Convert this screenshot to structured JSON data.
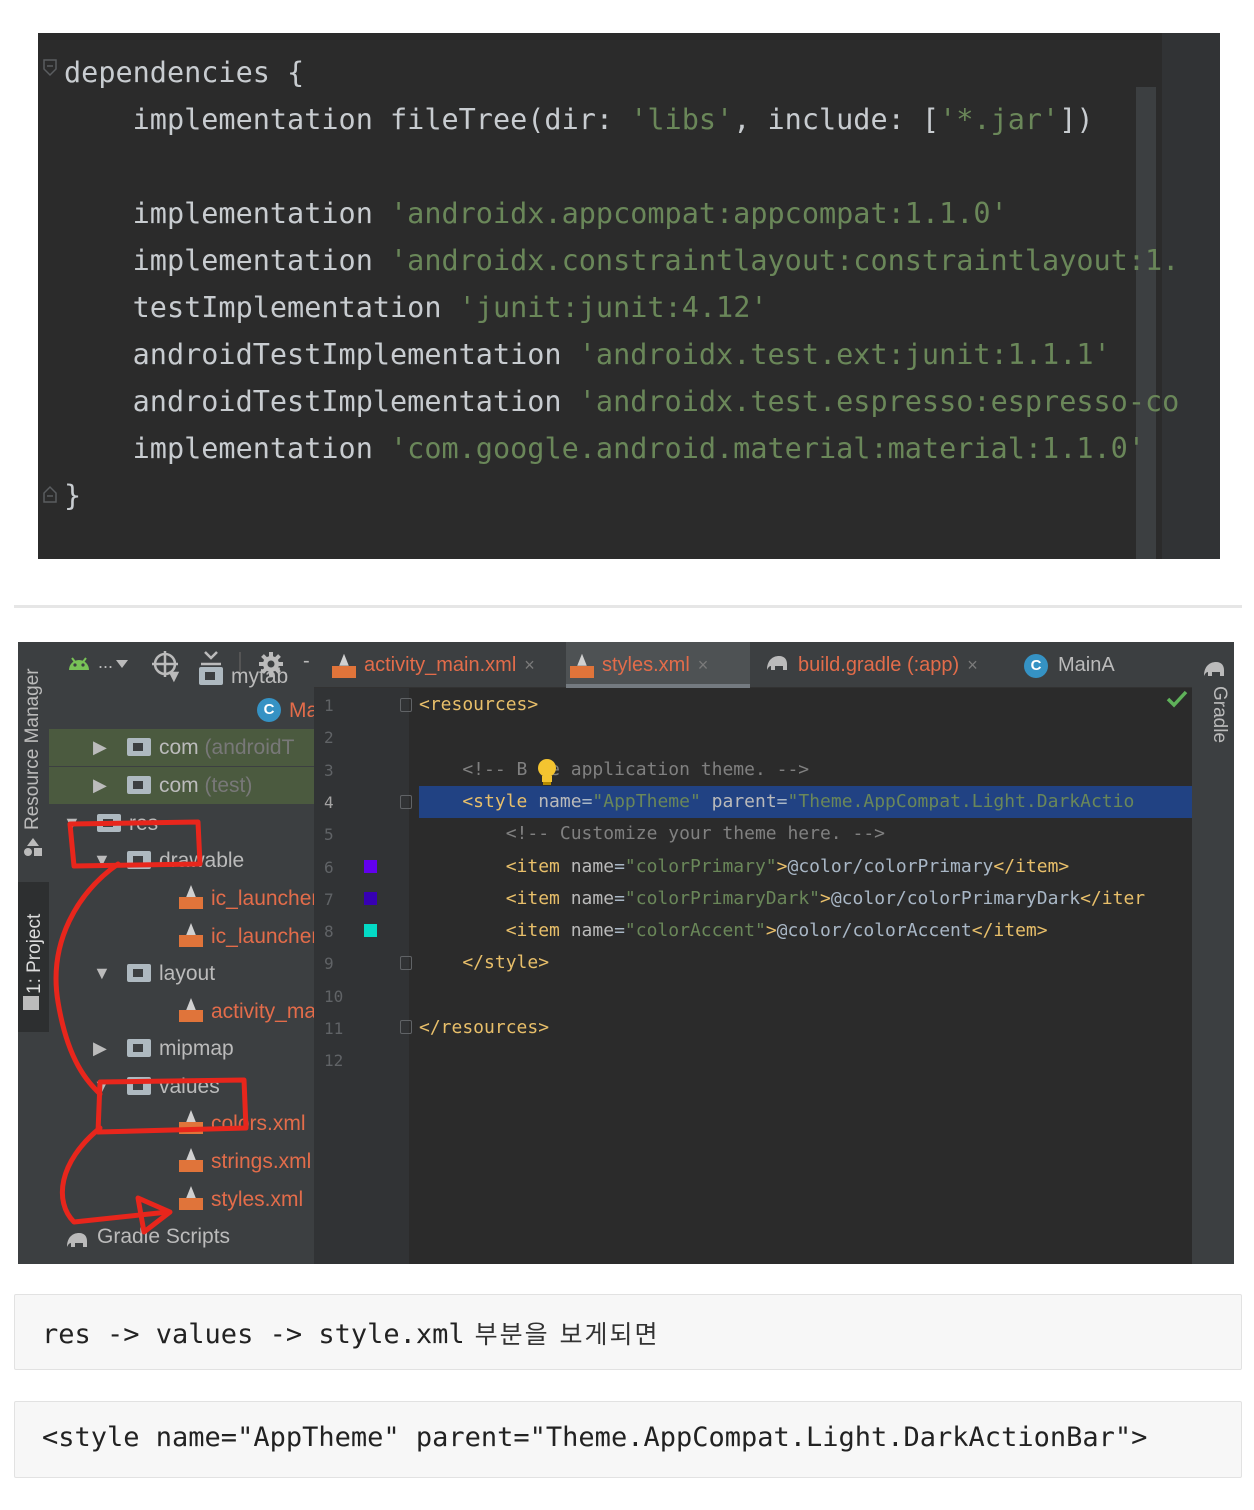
{
  "top_code": {
    "lines": [
      {
        "parts": [
          {
            "t": "dependencies {",
            "c": "plain"
          }
        ]
      },
      {
        "parts": [
          {
            "t": "    implementation fileTree(dir: ",
            "c": "plain"
          },
          {
            "t": "'libs'",
            "c": "str"
          },
          {
            "t": ", include: [",
            "c": "plain"
          },
          {
            "t": "'*.jar'",
            "c": "str"
          },
          {
            "t": "])",
            "c": "plain"
          }
        ]
      },
      {
        "parts": [
          {
            "t": "",
            "c": "plain"
          }
        ]
      },
      {
        "parts": [
          {
            "t": "    implementation ",
            "c": "plain"
          },
          {
            "t": "'androidx.appcompat:appcompat:1.1.0'",
            "c": "str"
          }
        ]
      },
      {
        "parts": [
          {
            "t": "    implementation ",
            "c": "plain"
          },
          {
            "t": "'androidx.constraintlayout:constraintlayout:1.",
            "c": "str"
          }
        ]
      },
      {
        "parts": [
          {
            "t": "    testImplementation ",
            "c": "plain"
          },
          {
            "t": "'junit:junit:4.12'",
            "c": "str"
          }
        ]
      },
      {
        "parts": [
          {
            "t": "    androidTestImplementation ",
            "c": "plain"
          },
          {
            "t": "'androidx.test.ext:junit:1.1.1'",
            "c": "str"
          }
        ]
      },
      {
        "parts": [
          {
            "t": "    androidTestImplementation ",
            "c": "plain"
          },
          {
            "t": "'androidx.test.espresso:espresso-co",
            "c": "str"
          }
        ]
      },
      {
        "parts": [
          {
            "t": "    implementation ",
            "c": "plain"
          },
          {
            "t": "'com.google.android.material:material:1.1.0'",
            "c": "str"
          }
        ]
      },
      {
        "parts": [
          {
            "t": "}",
            "c": "plain"
          }
        ]
      }
    ]
  },
  "side_tabs": {
    "resource_manager": "Resource Manager",
    "project": "1: Project",
    "gradle": "Gradle"
  },
  "toolbar": {
    "dots": "...",
    "hide": "-"
  },
  "tree": [
    {
      "label": "mytab",
      "icon": "folder-icon",
      "kind": "folder",
      "muted": ""
    },
    {
      "label": "Mai",
      "icon": "class-icon",
      "kind": "class",
      "muted": ""
    },
    {
      "label": "com",
      "icon": "folder-icon",
      "kind": "folder",
      "muted": " (androidT"
    },
    {
      "label": "com",
      "icon": "folder-icon",
      "kind": "folder",
      "muted": " (test)"
    },
    {
      "label": "res",
      "icon": "res-folder-icon",
      "kind": "folder",
      "muted": ""
    },
    {
      "label": "drawable",
      "icon": "folder-icon",
      "kind": "folder",
      "muted": ""
    },
    {
      "label": "ic_launcher",
      "icon": "xml-icon",
      "kind": "xml",
      "muted": ""
    },
    {
      "label": "ic_launcher",
      "icon": "xml-icon",
      "kind": "xml",
      "muted": ""
    },
    {
      "label": "layout",
      "icon": "folder-icon",
      "kind": "folder",
      "muted": ""
    },
    {
      "label": "activity_ma",
      "icon": "xml-icon",
      "kind": "xml",
      "muted": ""
    },
    {
      "label": "mipmap",
      "icon": "folder-icon",
      "kind": "folder",
      "muted": ""
    },
    {
      "label": "values",
      "icon": "folder-icon",
      "kind": "folder",
      "muted": ""
    },
    {
      "label": "colors.xml",
      "icon": "xml-icon",
      "kind": "xml",
      "muted": ""
    },
    {
      "label": "strings.xml",
      "icon": "xml-icon",
      "kind": "xml",
      "muted": ""
    },
    {
      "label": "styles.xml",
      "icon": "xml-icon",
      "kind": "xml",
      "muted": ""
    },
    {
      "label": "Gradle Scripts",
      "icon": "gradle-icon",
      "kind": "other",
      "muted": ""
    }
  ],
  "tabs": [
    {
      "label": "activity_main.xml",
      "icon": "xml-icon",
      "close": "×",
      "active": false
    },
    {
      "label": "styles.xml",
      "icon": "xml-icon",
      "close": "×",
      "active": true
    },
    {
      "label": "build.gradle (:app)",
      "icon": "gradle-icon",
      "close": "×",
      "active": false
    },
    {
      "label": "MainA",
      "icon": "class-icon",
      "close": "",
      "active": false
    }
  ],
  "editor_lines": [
    {
      "num": "1",
      "parts": [
        {
          "t": "<resources>",
          "c": "tag"
        }
      ]
    },
    {
      "num": "2",
      "parts": []
    },
    {
      "num": "3",
      "parts": [
        {
          "t": "    <!-- B",
          "c": "cmt"
        },
        {
          "t": "  ",
          "c": "cmt"
        },
        {
          "t": "e application theme. -->",
          "c": "cmt"
        }
      ]
    },
    {
      "num": "4",
      "parts": [
        {
          "t": "    <style ",
          "c": "tag"
        },
        {
          "t": "name",
          "c": "attr"
        },
        {
          "t": "=",
          "c": "plain"
        },
        {
          "t": "\"AppTheme\" ",
          "c": "aval"
        },
        {
          "t": "parent",
          "c": "attr"
        },
        {
          "t": "=",
          "c": "plain"
        },
        {
          "t": "\"Theme.AppCompat.Light.DarkActio",
          "c": "aval"
        }
      ]
    },
    {
      "num": "5",
      "parts": [
        {
          "t": "        <!-- Customize your theme here. -->",
          "c": "cmt"
        }
      ]
    },
    {
      "num": "6",
      "parts": [
        {
          "t": "        <item ",
          "c": "tag"
        },
        {
          "t": "name",
          "c": "attr"
        },
        {
          "t": "=",
          "c": "plain"
        },
        {
          "t": "\"colorPrimary\"",
          "c": "aval"
        },
        {
          "t": ">",
          "c": "tag"
        },
        {
          "t": "@color/colorPrimary",
          "c": "plain"
        },
        {
          "t": "</item>",
          "c": "tag"
        }
      ]
    },
    {
      "num": "7",
      "parts": [
        {
          "t": "        <item ",
          "c": "tag"
        },
        {
          "t": "name",
          "c": "attr"
        },
        {
          "t": "=",
          "c": "plain"
        },
        {
          "t": "\"colorPrimaryDark\"",
          "c": "aval"
        },
        {
          "t": ">",
          "c": "tag"
        },
        {
          "t": "@color/colorPrimaryDark",
          "c": "plain"
        },
        {
          "t": "</iter",
          "c": "tag"
        }
      ]
    },
    {
      "num": "8",
      "parts": [
        {
          "t": "        <item ",
          "c": "tag"
        },
        {
          "t": "name",
          "c": "attr"
        },
        {
          "t": "=",
          "c": "plain"
        },
        {
          "t": "\"colorAccent\"",
          "c": "aval"
        },
        {
          "t": ">",
          "c": "tag"
        },
        {
          "t": "@color/colorAccent",
          "c": "plain"
        },
        {
          "t": "</item>",
          "c": "tag"
        }
      ]
    },
    {
      "num": "9",
      "parts": [
        {
          "t": "    </style>",
          "c": "tag"
        }
      ]
    },
    {
      "num": "10",
      "parts": []
    },
    {
      "num": "11",
      "parts": [
        {
          "t": "</resources>",
          "c": "tag"
        }
      ]
    },
    {
      "num": "12",
      "parts": []
    }
  ],
  "swatches": {
    "colorPrimary": "#6200ee",
    "colorPrimaryDark": "#3700b3",
    "colorAccent": "#03dac5"
  },
  "colors": {
    "annotation_red": "#e8261c",
    "selection": "#214283",
    "string": "#6a8759",
    "tag": "#e8bf6a"
  },
  "text_block_1": {
    "code": "res -> values -> style.xml",
    "korean": " 부분을 보게되면"
  },
  "text_block_2": {
    "code": "<style name=\"AppTheme\" parent=\"Theme.AppCompat.Light.DarkActionBar\">"
  }
}
